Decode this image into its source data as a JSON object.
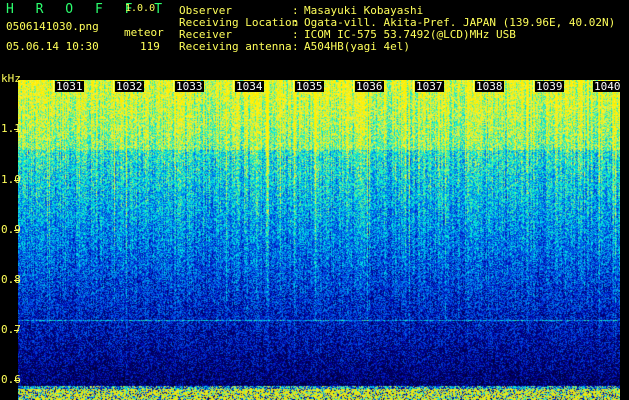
{
  "app": {
    "name": "H R O F F T",
    "version": "1.0.0"
  },
  "meta": {
    "filename": "0506141030.png",
    "datetime": "05.06.14 10:30",
    "event_type": "meteor",
    "event_count": "119"
  },
  "observation": {
    "fields": [
      {
        "label": "Observer",
        "value": "Masayuki Kobayashi"
      },
      {
        "label": "Receiving Location",
        "value": "Ogata-vill. Akita-Pref. JAPAN (139.96E, 40.02N)"
      },
      {
        "label": "Receiver",
        "value": "ICOM IC-575 53.7492(@LCD)MHz USB"
      },
      {
        "label": "Receiving antenna",
        "value": "A504HB(yagi 4el)"
      }
    ],
    "separator": ":"
  },
  "spectrogram": {
    "y_unit": "kHz",
    "y_ticks": [
      "1.1",
      "1.0",
      "0.9",
      "0.8",
      "0.7",
      "0.6"
    ],
    "x_ticks": [
      "1031",
      "1032",
      "1033",
      "1034",
      "1035",
      "1036",
      "1037",
      "1038",
      "1039",
      "1040"
    ],
    "colors": {
      "header_text": "#ffff5a",
      "app_title": "#2bff6e",
      "low": "#000060",
      "mid": "#1e6cff",
      "high": "#00ffb0",
      "peak": "#ffff00"
    }
  }
}
